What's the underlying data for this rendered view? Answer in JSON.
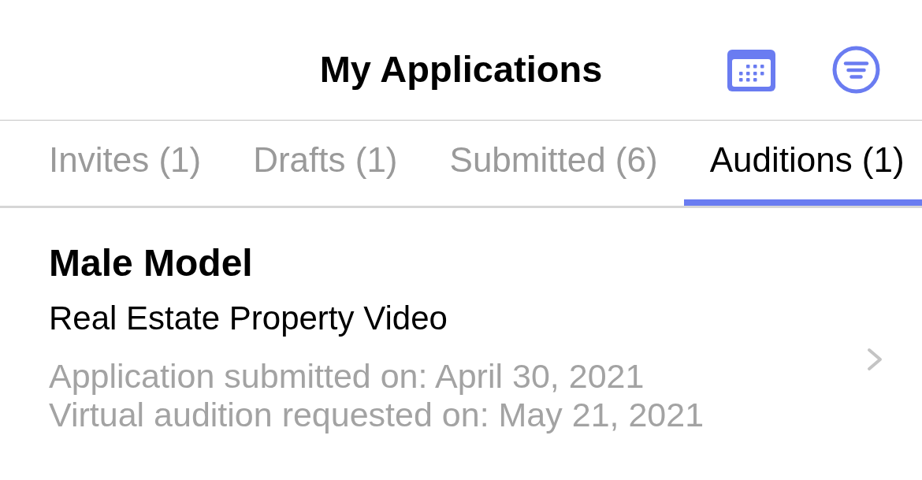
{
  "header": {
    "title": "My Applications"
  },
  "tabs": [
    {
      "label": "Invites (1)",
      "selected": false
    },
    {
      "label": "Drafts (1)",
      "selected": false
    },
    {
      "label": "Submitted (6)",
      "selected": false
    },
    {
      "label": "Auditions (1)",
      "selected": true
    }
  ],
  "applications": [
    {
      "role": "Male Model",
      "project": "Real Estate Property Video",
      "details": [
        "Application submitted on: April 30, 2021",
        "Virtual audition requested on: May 21, 2021"
      ]
    }
  ]
}
